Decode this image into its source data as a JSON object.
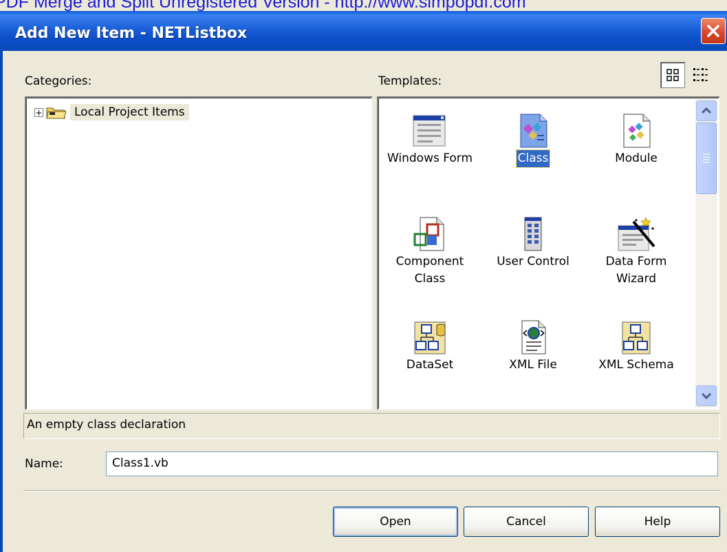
{
  "watermark": "PDF Merge and Split Unregistered Version - http://www.simpopdf.com",
  "window": {
    "title": "Add New Item - NETListbox",
    "close_icon": "close-icon"
  },
  "categories": {
    "label": "Categories:",
    "items": [
      {
        "label": "Local Project Items",
        "expander": "+",
        "icon": "folder-icon"
      }
    ]
  },
  "templates": {
    "label": "Templates:",
    "view_buttons": [
      "large-icons-view-icon",
      "small-icons-view-icon"
    ],
    "items": [
      {
        "label": "Windows Form",
        "icon": "windows-form-icon",
        "selected": false
      },
      {
        "label": "Class",
        "icon": "class-icon",
        "selected": true
      },
      {
        "label": "Module",
        "icon": "module-icon",
        "selected": false
      },
      {
        "label": "Component Class",
        "icon": "component-class-icon",
        "selected": false
      },
      {
        "label": "User Control",
        "icon": "user-control-icon",
        "selected": false
      },
      {
        "label": "Data Form Wizard",
        "icon": "data-form-wizard-icon",
        "selected": false
      },
      {
        "label": "DataSet",
        "icon": "dataset-icon",
        "selected": false
      },
      {
        "label": "XML File",
        "icon": "xml-file-icon",
        "selected": false
      },
      {
        "label": "XML Schema",
        "icon": "xml-schema-icon",
        "selected": false
      }
    ]
  },
  "description": "An empty class declaration",
  "name_field": {
    "label": "Name:",
    "value": "Class1.vb"
  },
  "buttons": {
    "open": "Open",
    "cancel": "Cancel",
    "help": "Help"
  },
  "colors": {
    "titlebar": "#0a49b8",
    "selection": "#316ac5",
    "dialog_bg": "#ece9d8",
    "watermark": "#1b1bd8"
  }
}
